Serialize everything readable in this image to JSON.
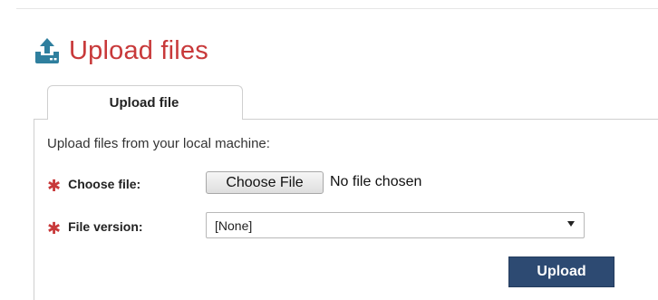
{
  "header": {
    "title": "Upload files",
    "icon": "upload-icon",
    "accent_color": "#c8393a",
    "icon_color": "#2f7f9e"
  },
  "tabs": [
    {
      "label": "Upload file",
      "active": true
    }
  ],
  "form": {
    "intro": "Upload files from your local machine:",
    "required_marker": "✱",
    "file": {
      "label": "Choose file:",
      "button_label": "Choose File",
      "status": "No file chosen"
    },
    "version": {
      "label": "File version:",
      "selected": "[None]"
    },
    "submit_label": "Upload",
    "submit_color": "#2d4a72"
  }
}
